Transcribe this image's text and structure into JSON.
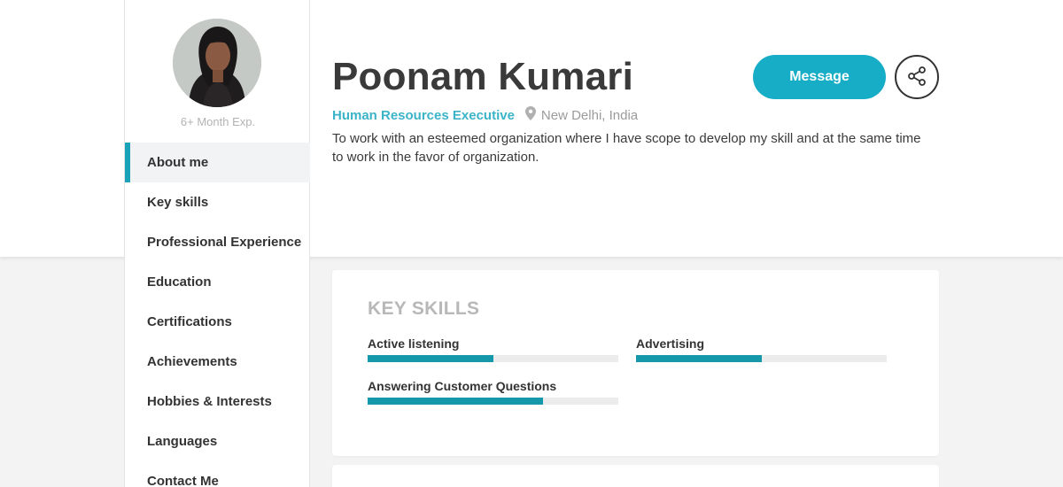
{
  "profile": {
    "name": "Poonam Kumari",
    "job_title": "Human Resources Executive",
    "location": "New Delhi, India",
    "experience": "6+ Month Exp.",
    "summary": "To work with an esteemed organization where I have scope to develop my skill and at the same time to work in the favor of organization."
  },
  "actions": {
    "message_label": "Message",
    "share_icon": "share-icon"
  },
  "sidebar": {
    "active_index": 0,
    "items": [
      {
        "label": "About me"
      },
      {
        "label": "Key skills"
      },
      {
        "label": "Professional Experience"
      },
      {
        "label": "Education"
      },
      {
        "label": "Certifications"
      },
      {
        "label": "Achievements"
      },
      {
        "label": "Hobbies & Interests"
      },
      {
        "label": "Languages"
      },
      {
        "label": "Contact Me"
      }
    ]
  },
  "key_skills": {
    "heading": "KEY SKILLS",
    "items": [
      {
        "name": "Active listening",
        "level": 0.5
      },
      {
        "name": "Advertising",
        "level": 0.5
      },
      {
        "name": "Answering Customer Questions",
        "level": 0.7
      }
    ]
  },
  "colors": {
    "accent": "#17adc6",
    "job_title": "#3bb3c8",
    "skill_bar": "#1598aa",
    "active_marker": "#1aa3b8"
  }
}
